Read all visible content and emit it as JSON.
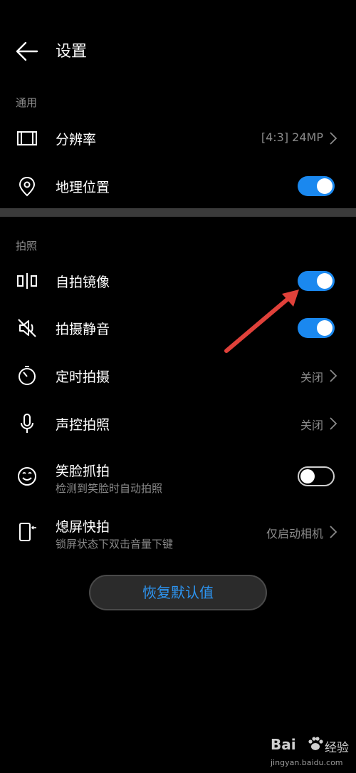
{
  "header": {
    "title": "设置"
  },
  "sections": {
    "general": "通用",
    "photo": "拍照"
  },
  "rows": {
    "resolution": {
      "label": "分辨率",
      "value": "[4:3] 24MP"
    },
    "location": {
      "label": "地理位置",
      "toggle": "on"
    },
    "mirror": {
      "label": "自拍镜像",
      "toggle": "on"
    },
    "mute": {
      "label": "拍摄静音",
      "toggle": "on"
    },
    "timer": {
      "label": "定时拍摄",
      "value": "关闭"
    },
    "voice": {
      "label": "声控拍照",
      "value": "关闭"
    },
    "smile": {
      "label": "笑脸抓拍",
      "sub": "检测到笑脸时自动拍照",
      "toggle": "off"
    },
    "quick": {
      "label": "熄屏快拍",
      "sub": "锁屏状态下双击音量下键",
      "value": "仅启动相机"
    }
  },
  "reset_label": "恢复默认值",
  "watermark": {
    "logo": "Bai",
    "text": "经验",
    "url": "jingyan.baidu.com"
  },
  "colors": {
    "accent": "#1a88ef",
    "reset_text": "#2d95f2",
    "annotation_arrow": "#e0413a"
  }
}
